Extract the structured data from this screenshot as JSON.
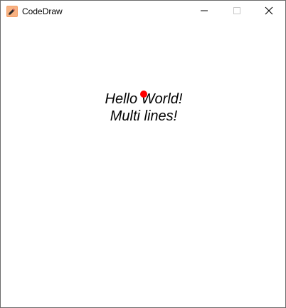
{
  "window": {
    "title": "CodeDraw",
    "app_icon": "pencil-app-icon",
    "controls": {
      "minimize_icon": "minimize-icon",
      "maximize_icon": "maximize-icon",
      "close_icon": "close-icon"
    }
  },
  "canvas": {
    "lines": [
      "Hello World!",
      "Multi lines!"
    ],
    "dot_color": "#ff0000",
    "text_color": "#000000",
    "background": "#ffffff"
  }
}
